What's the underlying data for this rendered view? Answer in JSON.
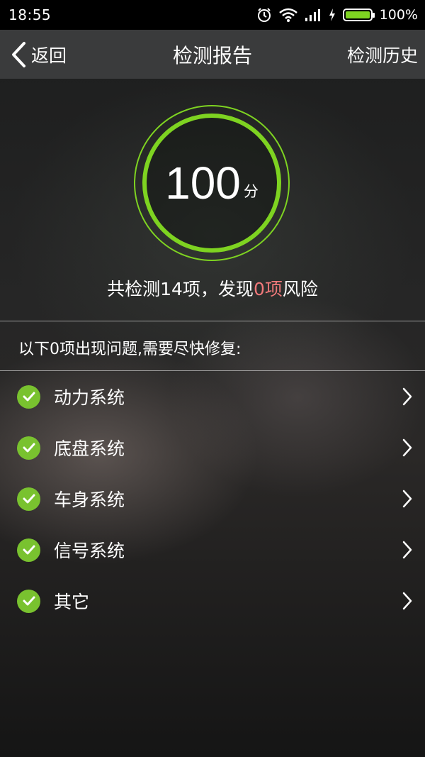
{
  "status_bar": {
    "time": "18:55",
    "battery_percent": "100%",
    "icons": [
      "alarm-icon",
      "wifi-icon",
      "signal-icon",
      "charging-icon",
      "battery-icon"
    ]
  },
  "nav": {
    "back_label": "返回",
    "title": "检测报告",
    "history_label": "检测历史"
  },
  "score": {
    "value": "100",
    "unit": "分",
    "ring_color": "#7ed321"
  },
  "summary": {
    "prefix": "共检测14项，发现",
    "risk_count": "0项",
    "suffix": "风险",
    "risk_color": "#f0797a"
  },
  "issues_header": "以下0项出现问题,需要尽快修复:",
  "systems": [
    {
      "label": "动力系统",
      "icon": "check-circle-icon"
    },
    {
      "label": "底盘系统",
      "icon": "check-circle-icon"
    },
    {
      "label": "车身系统",
      "icon": "check-circle-icon"
    },
    {
      "label": "信号系统",
      "icon": "check-circle-icon"
    },
    {
      "label": "其它",
      "icon": "check-circle-icon"
    }
  ]
}
